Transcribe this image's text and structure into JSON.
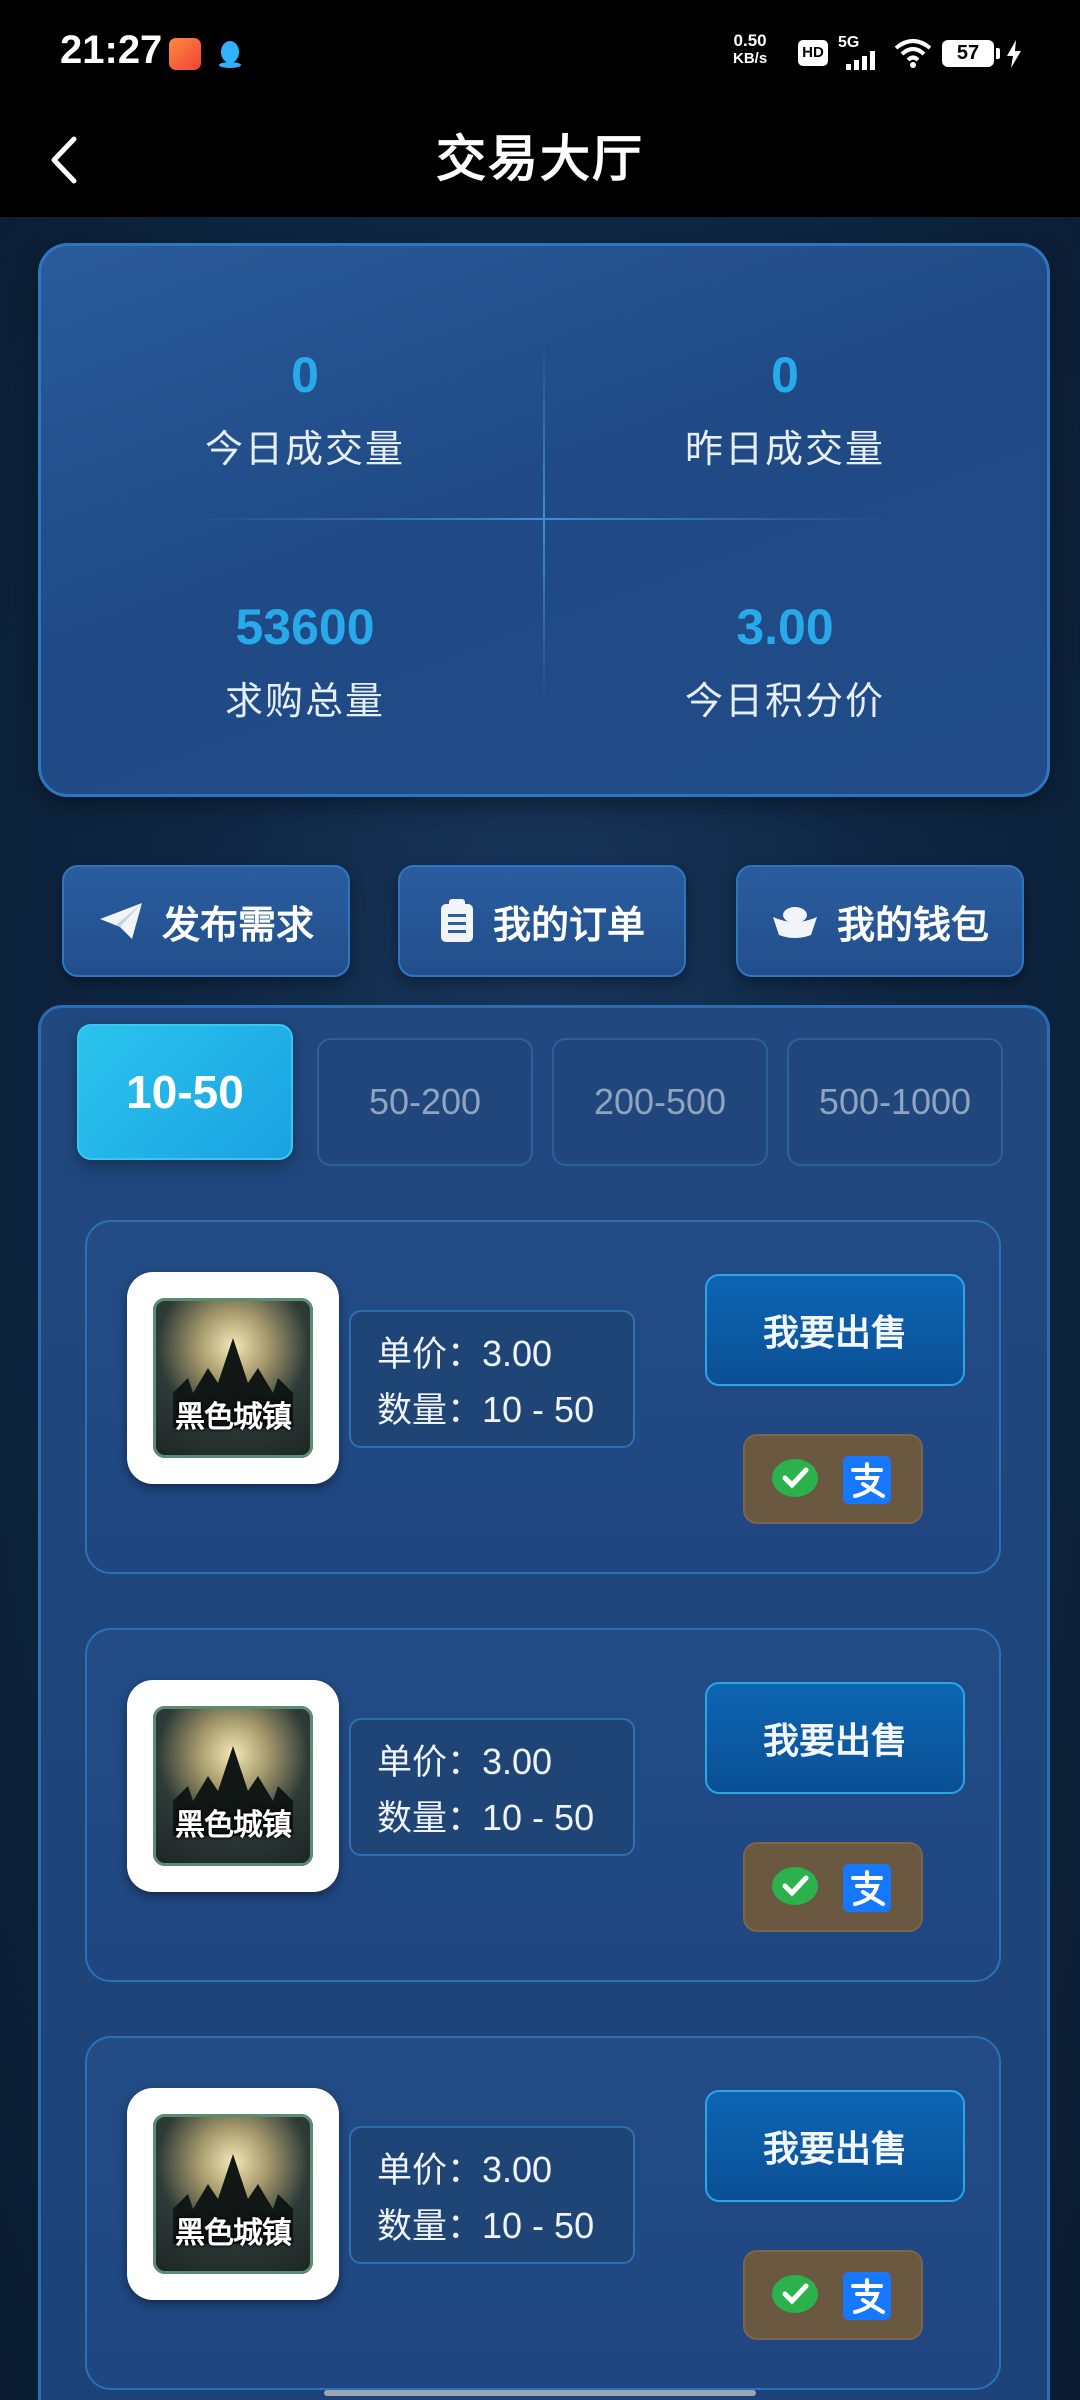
{
  "status_bar": {
    "time": "21:27",
    "net_speed_value": "0.50",
    "net_speed_unit": "KB/s",
    "hd_badge": "HD",
    "signal_label": "5G",
    "battery_level": "57"
  },
  "header": {
    "title": "交易大厅",
    "back_icon": "chevron-left-icon"
  },
  "stats": {
    "today_volume": {
      "value": "0",
      "label": "今日成交量"
    },
    "yesterday_volume": {
      "value": "0",
      "label": "昨日成交量"
    },
    "total_demand": {
      "value": "53600",
      "label": "求购总量"
    },
    "today_price": {
      "value": "3.00",
      "label": "今日积分价"
    }
  },
  "actions": {
    "publish": {
      "label": "发布需求",
      "icon": "paper-plane-icon"
    },
    "orders": {
      "label": "我的订单",
      "icon": "clipboard-icon"
    },
    "wallet": {
      "label": "我的钱包",
      "icon": "gold-ingot-icon"
    }
  },
  "tabs": [
    {
      "label": "10-50",
      "active": true
    },
    {
      "label": "50-200",
      "active": false
    },
    {
      "label": "200-500",
      "active": false
    },
    {
      "label": "500-1000",
      "active": false
    }
  ],
  "orders": [
    {
      "game_name": "黑色城镇",
      "price_label": "单价：",
      "price": "3.00",
      "qty_label": "数量：",
      "qty": "10 - 50",
      "sell_label": "我要出售",
      "payment_icons": [
        "wechat-pay-icon",
        "alipay-icon"
      ]
    },
    {
      "game_name": "黑色城镇",
      "price_label": "单价：",
      "price": "3.00",
      "qty_label": "数量：",
      "qty": "10 - 50",
      "sell_label": "我要出售",
      "payment_icons": [
        "wechat-pay-icon",
        "alipay-icon"
      ]
    },
    {
      "game_name": "黑色城镇",
      "price_label": "单价：",
      "price": "3.00",
      "qty_label": "数量：",
      "qty": "10 - 50",
      "sell_label": "我要出售",
      "payment_icons": [
        "wechat-pay-icon",
        "alipay-icon"
      ]
    }
  ],
  "colors": {
    "accent_cyan": "#27a9ea",
    "card_blue": "#214c88",
    "sell_button": "#0d66b3",
    "pay_box": "#6b5840",
    "wechat_green": "#2bb24c",
    "alipay_blue": "#1677ff"
  }
}
